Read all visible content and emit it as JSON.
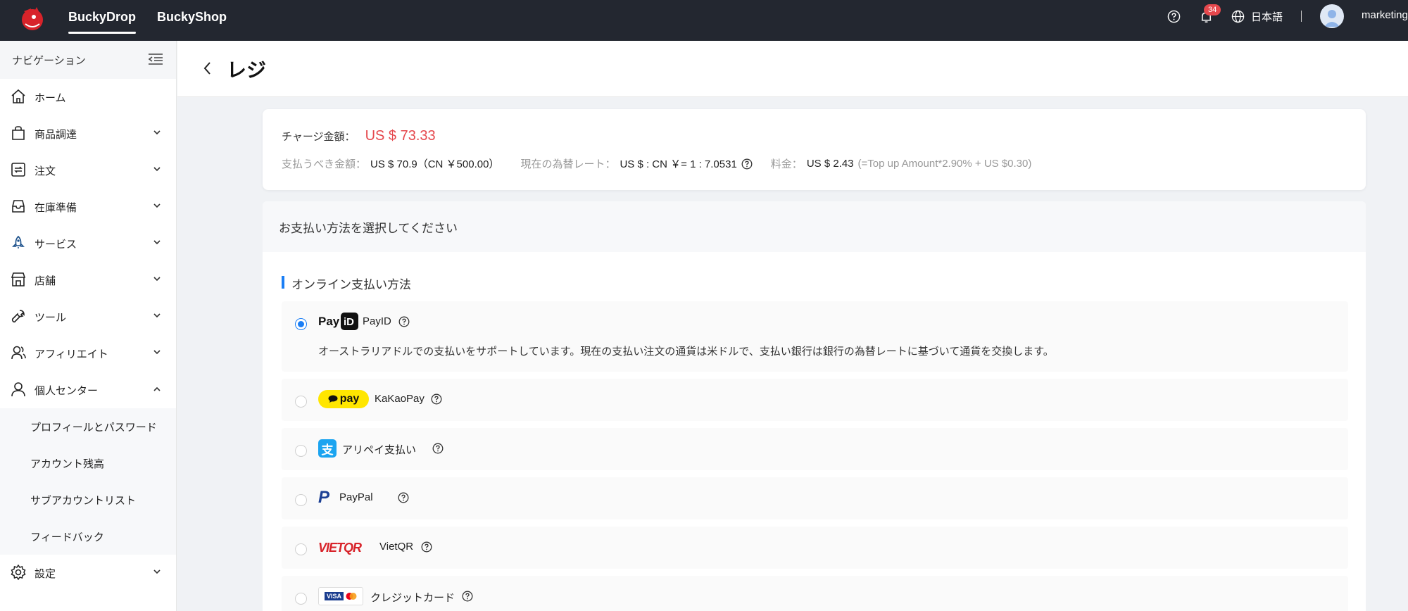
{
  "topbar": {
    "tabs": [
      {
        "label": "BuckyDrop",
        "active": true
      },
      {
        "label": "BuckyShop",
        "active": false
      }
    ],
    "notification_count": "34",
    "language": "日本語",
    "user": "marketing"
  },
  "sidebar": {
    "header": "ナビゲーション",
    "items": [
      {
        "label": "ホーム",
        "icon": "home-icon"
      },
      {
        "label": "商品調達",
        "icon": "bag-icon"
      },
      {
        "label": "注文",
        "icon": "order-icon"
      },
      {
        "label": "在庫準備",
        "icon": "inbox-icon"
      },
      {
        "label": "サービス",
        "icon": "rocket-icon"
      },
      {
        "label": "店舗",
        "icon": "store-icon"
      },
      {
        "label": "ツール",
        "icon": "wrench-icon"
      },
      {
        "label": "アフィリエイト",
        "icon": "affiliate-icon"
      },
      {
        "label": "個人センター",
        "icon": "user-icon",
        "expanded": true
      }
    ],
    "sub_items": [
      "プロフィールとパスワード",
      "アカウント残高",
      "サブアカウントリスト",
      "フィードバック"
    ],
    "settings": {
      "label": "設定",
      "icon": "gear-icon"
    }
  },
  "page": {
    "title": "レジ"
  },
  "amount": {
    "charge_label": "チャージ金額：",
    "charge_value": "US $ 73.33",
    "payable_label": "支払うべき金額：",
    "payable_value": "US $ 70.9（CN ￥500.00）",
    "rate_label": "現在の為替レート：",
    "rate_value": "US $ : CN ￥= 1 : 7.0531",
    "fee_label": "料金：",
    "fee_value": "US $ 2.43",
    "fee_formula": "(=Top up Amount*2.90% + US $0.30)"
  },
  "payment": {
    "heading": "お支払い方法を選択してください",
    "section": "オンライン支払い方法",
    "methods": [
      {
        "name": "PayID",
        "logo_text": "Pay",
        "checked": true,
        "description": "オーストラリアドルでの支払いをサポートしています。現在の支払い注文の通貨は米ドルで、支払い銀行は銀行の為替レートに基づいて通貨を交換します。"
      },
      {
        "name": "KaKaoPay",
        "logo_text": "pay",
        "checked": false
      },
      {
        "name": "アリペイ支払い",
        "logo_text": "支",
        "checked": false
      },
      {
        "name": "PayPal",
        "logo_text": "P",
        "checked": false
      },
      {
        "name": "VietQR",
        "logo_text": "VIETQR",
        "checked": false
      },
      {
        "name": "クレジットカード",
        "logo_text": "VISA",
        "checked": false
      }
    ]
  }
}
